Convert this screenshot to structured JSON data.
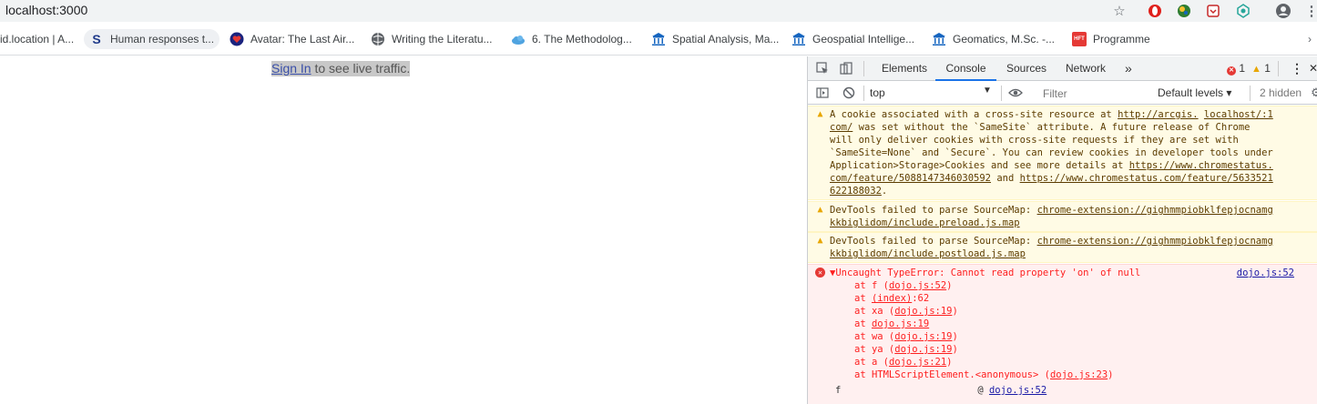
{
  "browser": {
    "url": "localhost:3000",
    "icons": [
      "star-icon",
      "opera-icon",
      "globe-extension-icon",
      "pocket-icon",
      "extension-icon",
      "account-icon",
      "menu-icon"
    ]
  },
  "bookmarks": [
    {
      "label": "id.location | A...",
      "icon": "none"
    },
    {
      "label": "Human responses t...",
      "icon": "s-icon"
    },
    {
      "label": "Avatar: The Last Air...",
      "icon": "heart-icon"
    },
    {
      "label": "Writing the Literatu...",
      "icon": "globe-icon"
    },
    {
      "label": "6. The Methodolog...",
      "icon": "cloud-icon"
    },
    {
      "label": "Spatial Analysis, Ma...",
      "icon": "university-icon"
    },
    {
      "label": "Geospatial Intellige...",
      "icon": "university-icon"
    },
    {
      "label": "Geomatics, M.Sc. -...",
      "icon": "university-icon"
    },
    {
      "label": "Programme",
      "icon": "hft-icon"
    }
  ],
  "page": {
    "signin_link": "Sign In",
    "signin_text": " to see live traffic."
  },
  "devtools": {
    "tabs": [
      "Elements",
      "Console",
      "Sources",
      "Network"
    ],
    "active_tab": "Console",
    "more": "»",
    "error_count": "1",
    "warning_count": "1",
    "context": "top",
    "filter_placeholder": "Filter",
    "levels": "Default levels ▾",
    "hidden": "2 hidden"
  },
  "console": {
    "warning1": {
      "line1_pre": "A cookie associated with a cross-site resource at ",
      "line1_link1": "http://arcgis.",
      "line1_link2": "localhost/:1",
      "line2_link": "com/",
      "line2_rest": " was set without the `SameSite` attribute. A future release of Chrome",
      "line3": "will only deliver cookies with cross-site requests if they are set with",
      "line4": "`SameSite=None` and `Secure`. You can review cookies in developer tools under",
      "line5_pre": "Application>Storage>Cookies and see more details at ",
      "line5_link": "https://www.chromestatus.",
      "line6_link1": "com/feature/5088147346030592",
      "line6_mid": " and ",
      "line6_link2": "https://www.chromestatus.com/feature/5633521",
      "line7_link": "622188032",
      "line7_end": "."
    },
    "warning2": {
      "pre": "DevTools failed to parse SourceMap: ",
      "link1": "chrome-extension://gighmmpiobklfepjocnamg",
      "link2": "kkbiglidom/include.preload.js.map"
    },
    "warning3": {
      "pre": "DevTools failed to parse SourceMap: ",
      "link1": "chrome-extension://gighmmpiobklfepjocnamg",
      "link2": "kkbiglidom/include.postload.js.map"
    },
    "error": {
      "message": "▼Uncaught TypeError: Cannot read property 'on' of null",
      "source": "dojo.js:52",
      "stack": [
        {
          "pre": "at f (",
          "link": "dojo.js:52",
          "post": ")"
        },
        {
          "pre": "at ",
          "link": "(index)",
          "post": ":62"
        },
        {
          "pre": "at xa (",
          "link": "dojo.js:19",
          "post": ")"
        },
        {
          "pre": "at ",
          "link": "dojo.js:19",
          "post": ""
        },
        {
          "pre": "at wa (",
          "link": "dojo.js:19",
          "post": ")"
        },
        {
          "pre": "at ya (",
          "link": "dojo.js:19",
          "post": ")"
        },
        {
          "pre": "at a (",
          "link": "dojo.js:21",
          "post": ")"
        },
        {
          "pre": "at HTMLScriptElement.<anonymous> (",
          "link": "dojo.js:23",
          "post": ")"
        }
      ],
      "f_line": "f",
      "f_at": "@ ",
      "f_link": "dojo.js:52"
    }
  }
}
